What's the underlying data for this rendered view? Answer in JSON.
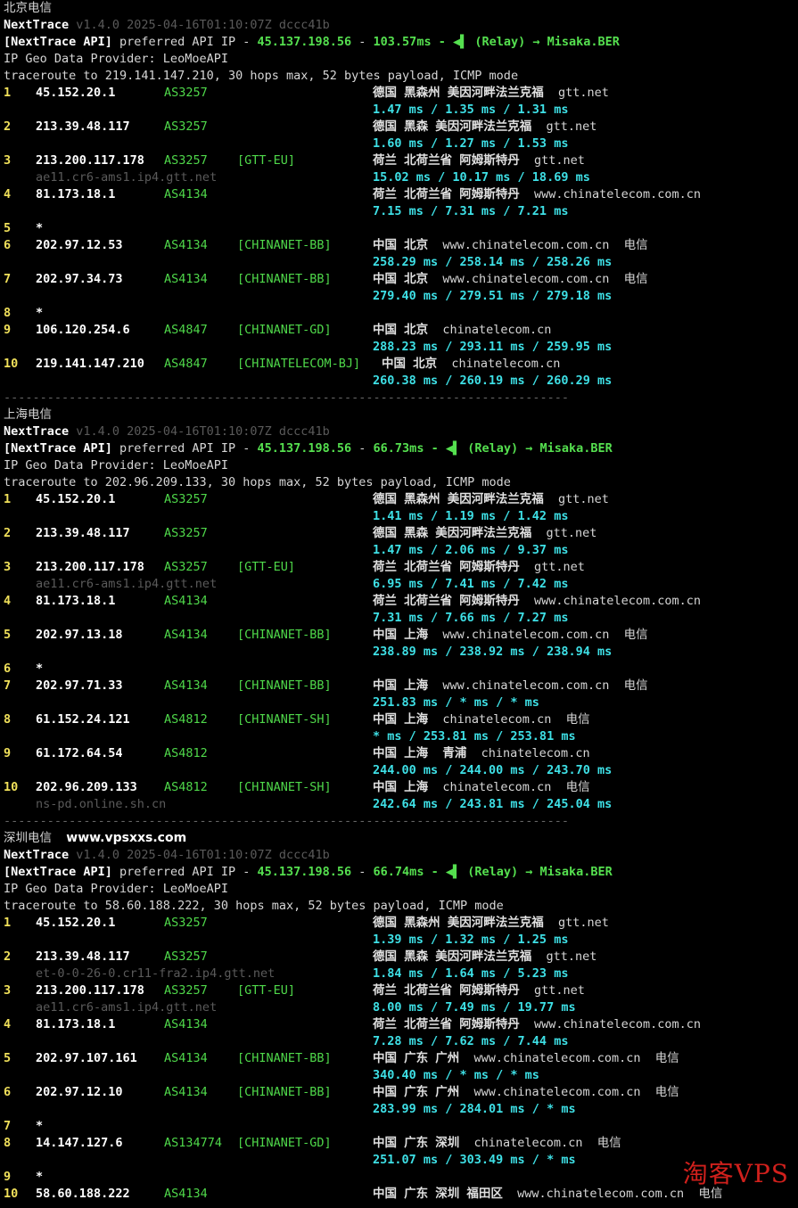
{
  "watermark": "淘客VPS",
  "blocks": [
    {
      "title": "北京电信",
      "site": "",
      "version_name": "NextTrace",
      "version_rest": " v1.4.0 2025-04-16T01:10:07Z dccc41b",
      "api_label": "[NextTrace API]",
      "api_text": " preferred API IP - ",
      "api_ip": "45.137.198.56",
      "api_sep": " - ",
      "api_latency": "103.57ms",
      "api_relay": " - ◀▌ (Relay) → Misaka.BER",
      "geo_provider": "IP Geo Data Provider: LeoMoeAPI",
      "traceroute": "traceroute to 219.141.147.210, 30 hops max, 52 bytes payload, ICMP mode",
      "hops": [
        {
          "n": "1",
          "ip": "45.152.20.1",
          "as": "AS3257",
          "tag": "",
          "geo": "德国 黑森州 美因河畔法兰克福",
          "domain": "gtt.net",
          "isp": "",
          "rdns": "",
          "rtt": "1.47 ms / 1.35 ms / 1.31 ms"
        },
        {
          "n": "2",
          "ip": "213.39.48.117",
          "as": "AS3257",
          "tag": "",
          "geo": "德国 黑森 美因河畔法兰克福",
          "domain": "gtt.net",
          "isp": "",
          "rdns": "",
          "rtt": "1.60 ms / 1.27 ms / 1.53 ms"
        },
        {
          "n": "3",
          "ip": "213.200.117.178",
          "as": "AS3257",
          "tag": "[GTT-EU]",
          "geo": "荷兰 北荷兰省 阿姆斯特丹",
          "domain": "gtt.net",
          "isp": "",
          "rdns": "ae11.cr6-ams1.ip4.gtt.net",
          "rtt": "15.02 ms / 10.17 ms / 18.69 ms"
        },
        {
          "n": "4",
          "ip": "81.173.18.1",
          "as": "AS4134",
          "tag": "",
          "geo": "荷兰 北荷兰省 阿姆斯特丹",
          "domain": "www.chinatelecom.com.cn",
          "isp": "",
          "rdns": "",
          "rtt": "7.15 ms / 7.31 ms / 7.21 ms"
        },
        {
          "n": "5",
          "star": "*"
        },
        {
          "n": "6",
          "ip": "202.97.12.53",
          "as": "AS4134",
          "tag": "[CHINANET-BB]",
          "geo": "中国 北京",
          "domain": "www.chinatelecom.com.cn",
          "isp": "电信",
          "rdns": "",
          "rtt": "258.29 ms / 258.14 ms / 258.26 ms"
        },
        {
          "n": "7",
          "ip": "202.97.34.73",
          "as": "AS4134",
          "tag": "[CHINANET-BB]",
          "geo": "中国 北京",
          "domain": "www.chinatelecom.com.cn",
          "isp": "电信",
          "rdns": "",
          "rtt": "279.40 ms / 279.51 ms / 279.18 ms"
        },
        {
          "n": "8",
          "star": "*"
        },
        {
          "n": "9",
          "ip": "106.120.254.6",
          "as": "AS4847",
          "tag": "[CHINANET-GD]",
          "geo": "中国 北京",
          "domain": "chinatelecom.cn",
          "isp": "",
          "rdns": "",
          "rtt": "288.23 ms / 293.11 ms / 259.95 ms"
        },
        {
          "n": "10",
          "ip": "219.141.147.210",
          "as": "AS4847",
          "tag": "[CHINATELECOM-BJ]",
          "geo": "中国 北京",
          "domain": "chinatelecom.cn",
          "isp": "",
          "rdns": "",
          "rtt": "260.38 ms / 260.19 ms / 260.29 ms",
          "shift": true
        }
      ]
    },
    {
      "title": "上海电信",
      "site": "",
      "version_name": "NextTrace",
      "version_rest": " v1.4.0 2025-04-16T01:10:07Z dccc41b",
      "api_label": "[NextTrace API]",
      "api_text": " preferred API IP - ",
      "api_ip": "45.137.198.56",
      "api_sep": " - ",
      "api_latency": "66.73ms",
      "api_relay": " - ◀▌ (Relay) → Misaka.BER",
      "geo_provider": "IP Geo Data Provider: LeoMoeAPI",
      "traceroute": "traceroute to 202.96.209.133, 30 hops max, 52 bytes payload, ICMP mode",
      "hops": [
        {
          "n": "1",
          "ip": "45.152.20.1",
          "as": "AS3257",
          "tag": "",
          "geo": "德国 黑森州 美因河畔法兰克福",
          "domain": "gtt.net",
          "isp": "",
          "rdns": "",
          "rtt": "1.41 ms / 1.19 ms / 1.42 ms"
        },
        {
          "n": "2",
          "ip": "213.39.48.117",
          "as": "AS3257",
          "tag": "",
          "geo": "德国 黑森 美因河畔法兰克福",
          "domain": "gtt.net",
          "isp": "",
          "rdns": "",
          "rtt": "1.47 ms / 2.06 ms / 9.37 ms"
        },
        {
          "n": "3",
          "ip": "213.200.117.178",
          "as": "AS3257",
          "tag": "[GTT-EU]",
          "geo": "荷兰 北荷兰省 阿姆斯特丹",
          "domain": "gtt.net",
          "isp": "",
          "rdns": "ae11.cr6-ams1.ip4.gtt.net",
          "rtt": "6.95 ms / 7.41 ms / 7.42 ms"
        },
        {
          "n": "4",
          "ip": "81.173.18.1",
          "as": "AS4134",
          "tag": "",
          "geo": "荷兰 北荷兰省 阿姆斯特丹",
          "domain": "www.chinatelecom.com.cn",
          "isp": "",
          "rdns": "",
          "rtt": "7.31 ms / 7.66 ms / 7.27 ms"
        },
        {
          "n": "5",
          "ip": "202.97.13.18",
          "as": "AS4134",
          "tag": "[CHINANET-BB]",
          "geo": "中国 上海",
          "domain": "www.chinatelecom.com.cn",
          "isp": "电信",
          "rdns": "",
          "rtt": "238.89 ms / 238.92 ms / 238.94 ms"
        },
        {
          "n": "6",
          "star": "*"
        },
        {
          "n": "7",
          "ip": "202.97.71.33",
          "as": "AS4134",
          "tag": "[CHINANET-BB]",
          "geo": "中国 上海",
          "domain": "www.chinatelecom.com.cn",
          "isp": "电信",
          "rdns": "",
          "rtt": "251.83 ms / * ms / * ms"
        },
        {
          "n": "8",
          "ip": "61.152.24.121",
          "as": "AS4812",
          "tag": "[CHINANET-SH]",
          "geo": "中国 上海",
          "domain": "chinatelecom.cn",
          "isp": "电信",
          "rdns": "",
          "rtt": "* ms / 253.81 ms / 253.81 ms"
        },
        {
          "n": "9",
          "ip": "61.172.64.54",
          "as": "AS4812",
          "tag": "",
          "geo": "中国 上海  青浦",
          "domain": "chinatelecom.cn",
          "isp": "",
          "rdns": "",
          "rtt": "244.00 ms / 244.00 ms / 243.70 ms"
        },
        {
          "n": "10",
          "ip": "202.96.209.133",
          "as": "AS4812",
          "tag": "[CHINANET-SH]",
          "geo": "中国 上海",
          "domain": "chinatelecom.cn",
          "isp": "电信",
          "rdns": "ns-pd.online.sh.cn",
          "rtt": "242.64 ms / 243.81 ms / 245.04 ms"
        }
      ]
    },
    {
      "title": "深圳电信",
      "site": "www.vpsxxs.com",
      "version_name": "NextTrace",
      "version_rest": " v1.4.0 2025-04-16T01:10:07Z dccc41b",
      "api_label": "[NextTrace API]",
      "api_text": " preferred API IP - ",
      "api_ip": "45.137.198.56",
      "api_sep": " - ",
      "api_latency": "66.74ms",
      "api_relay": " - ◀▌ (Relay) → Misaka.BER",
      "geo_provider": "IP Geo Data Provider: LeoMoeAPI",
      "traceroute": "traceroute to 58.60.188.222, 30 hops max, 52 bytes payload, ICMP mode",
      "hops": [
        {
          "n": "1",
          "ip": "45.152.20.1",
          "as": "AS3257",
          "tag": "",
          "geo": "德国 黑森州 美因河畔法兰克福",
          "domain": "gtt.net",
          "isp": "",
          "rdns": "",
          "rtt": "1.39 ms / 1.32 ms / 1.25 ms"
        },
        {
          "n": "2",
          "ip": "213.39.48.117",
          "as": "AS3257",
          "tag": "",
          "geo": "德国 黑森 美因河畔法兰克福",
          "domain": "gtt.net",
          "isp": "",
          "rdns": "et-0-0-26-0.cr11-fra2.ip4.gtt.net",
          "rtt": "1.84 ms / 1.64 ms / 5.23 ms"
        },
        {
          "n": "3",
          "ip": "213.200.117.178",
          "as": "AS3257",
          "tag": "[GTT-EU]",
          "geo": "荷兰 北荷兰省 阿姆斯特丹",
          "domain": "gtt.net",
          "isp": "",
          "rdns": "ae11.cr6-ams1.ip4.gtt.net",
          "rtt": "8.00 ms / 7.49 ms / 19.77 ms"
        },
        {
          "n": "4",
          "ip": "81.173.18.1",
          "as": "AS4134",
          "tag": "",
          "geo": "荷兰 北荷兰省 阿姆斯特丹",
          "domain": "www.chinatelecom.com.cn",
          "isp": "",
          "rdns": "",
          "rtt": "7.28 ms / 7.62 ms / 7.44 ms"
        },
        {
          "n": "5",
          "ip": "202.97.107.161",
          "as": "AS4134",
          "tag": "[CHINANET-BB]",
          "geo": "中国 广东 广州",
          "domain": "www.chinatelecom.com.cn",
          "isp": "电信",
          "rdns": "",
          "rtt": "340.40 ms / * ms / * ms"
        },
        {
          "n": "6",
          "ip": "202.97.12.10",
          "as": "AS4134",
          "tag": "[CHINANET-BB]",
          "geo": "中国 广东 广州",
          "domain": "www.chinatelecom.com.cn",
          "isp": "电信",
          "rdns": "",
          "rtt": "283.99 ms / 284.01 ms / * ms"
        },
        {
          "n": "7",
          "star": "*"
        },
        {
          "n": "8",
          "ip": "14.147.127.6",
          "as": "AS134774",
          "tag": "[CHINANET-GD]",
          "geo": "中国 广东 深圳",
          "domain": "chinatelecom.cn",
          "isp": "电信",
          "rdns": "",
          "rtt": "251.07 ms / 303.49 ms / * ms"
        },
        {
          "n": "9",
          "star": "*"
        },
        {
          "n": "10",
          "ip": "58.60.188.222",
          "as": "AS4134",
          "tag": "",
          "geo": "中国 广东 深圳 福田区",
          "domain": "www.chinatelecom.com.cn",
          "isp": "电信",
          "rdns": "",
          "rtt": ""
        }
      ]
    }
  ]
}
